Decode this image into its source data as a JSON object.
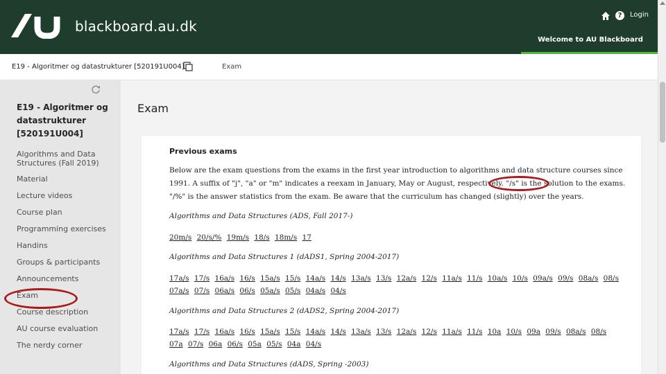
{
  "header": {
    "brand": "blackboard.au.dk",
    "login_label": "Login",
    "welcome_tab": "Welcome to AU Blackboard"
  },
  "breadcrumb": {
    "course": "E19 - Algoritmer og datastrukturer [520191U004]",
    "page": "Exam"
  },
  "sidebar": {
    "course_title": "E19 - Algoritmer og datastrukturer [520191U004]",
    "items": [
      {
        "label": "Algorithms and Data Structures (Fall 2019)"
      },
      {
        "label": "Material"
      },
      {
        "label": "Lecture videos"
      },
      {
        "label": "Course plan"
      },
      {
        "label": "Programming exercises"
      },
      {
        "label": "Handins"
      },
      {
        "label": "Groups & participants"
      },
      {
        "label": "Announcements"
      },
      {
        "label": "Exam"
      },
      {
        "label": "Course description"
      },
      {
        "label": "AU course evaluation"
      },
      {
        "label": "The nerdy corner"
      }
    ]
  },
  "main": {
    "page_title": "Exam",
    "section_title": "Previous exams",
    "intro": "Below are the exam questions from the exams in the first year introduction to algorithms and data structure courses since 1991. A suffix of \"j\", \"a\" or \"m\" indicates a reexam in January, May or August, respectively. \"/s\" is the solution to the exams. \"/%\" is the answer statistics from the exam. Be aware that the curriculum has changed (slightly) over the years.",
    "groups": [
      {
        "title": "Algorithms and Data Structures (ADS, Fall 2017-)",
        "links": [
          "20m/s",
          "20/s/%",
          "19m/s",
          "18/s",
          "18m/s",
          "17"
        ]
      },
      {
        "title": "Algorithms and Data Structures 1 (dADS1, Spring 2004-2017)",
        "links": [
          "17a/s",
          "17/s",
          "16a/s",
          "16/s",
          "15a/s",
          "15/s",
          "14a/s",
          "14/s",
          "13a/s",
          "13/s",
          "12a/s",
          "12/s",
          "11a/s",
          "11/s",
          "10a/s",
          "10/s",
          "09a/s",
          "09/s",
          "08a/s",
          "08/s",
          "07a/s",
          "07/s",
          "06a/s",
          "06/s",
          "05a/s",
          "05/s",
          "04a/s",
          "04/s"
        ]
      },
      {
        "title": "Algorithms and Data Structures 2 (dADS2, Spring 2004-2017)",
        "links": [
          "17a/s",
          "17/s",
          "16a/s",
          "16/s",
          "15a/s",
          "15/s",
          "14a/s",
          "14/s",
          "13a/s",
          "13/s",
          "12a/s",
          "12/s",
          "11a/s",
          "11/s",
          "10a",
          "10/s",
          "09a",
          "09/s",
          "08a/s",
          "08/s",
          "07a",
          "07/s",
          "06a",
          "06/s",
          "05a",
          "05/s",
          "04a",
          "04/s"
        ]
      },
      {
        "title": "Algorithms and Data Structures (dADS, Spring -2003)",
        "links": []
      }
    ]
  },
  "colors": {
    "header_bg": "#1e3d2c",
    "accent_green": "#58b33e",
    "annotation_red": "#a81c1c"
  }
}
